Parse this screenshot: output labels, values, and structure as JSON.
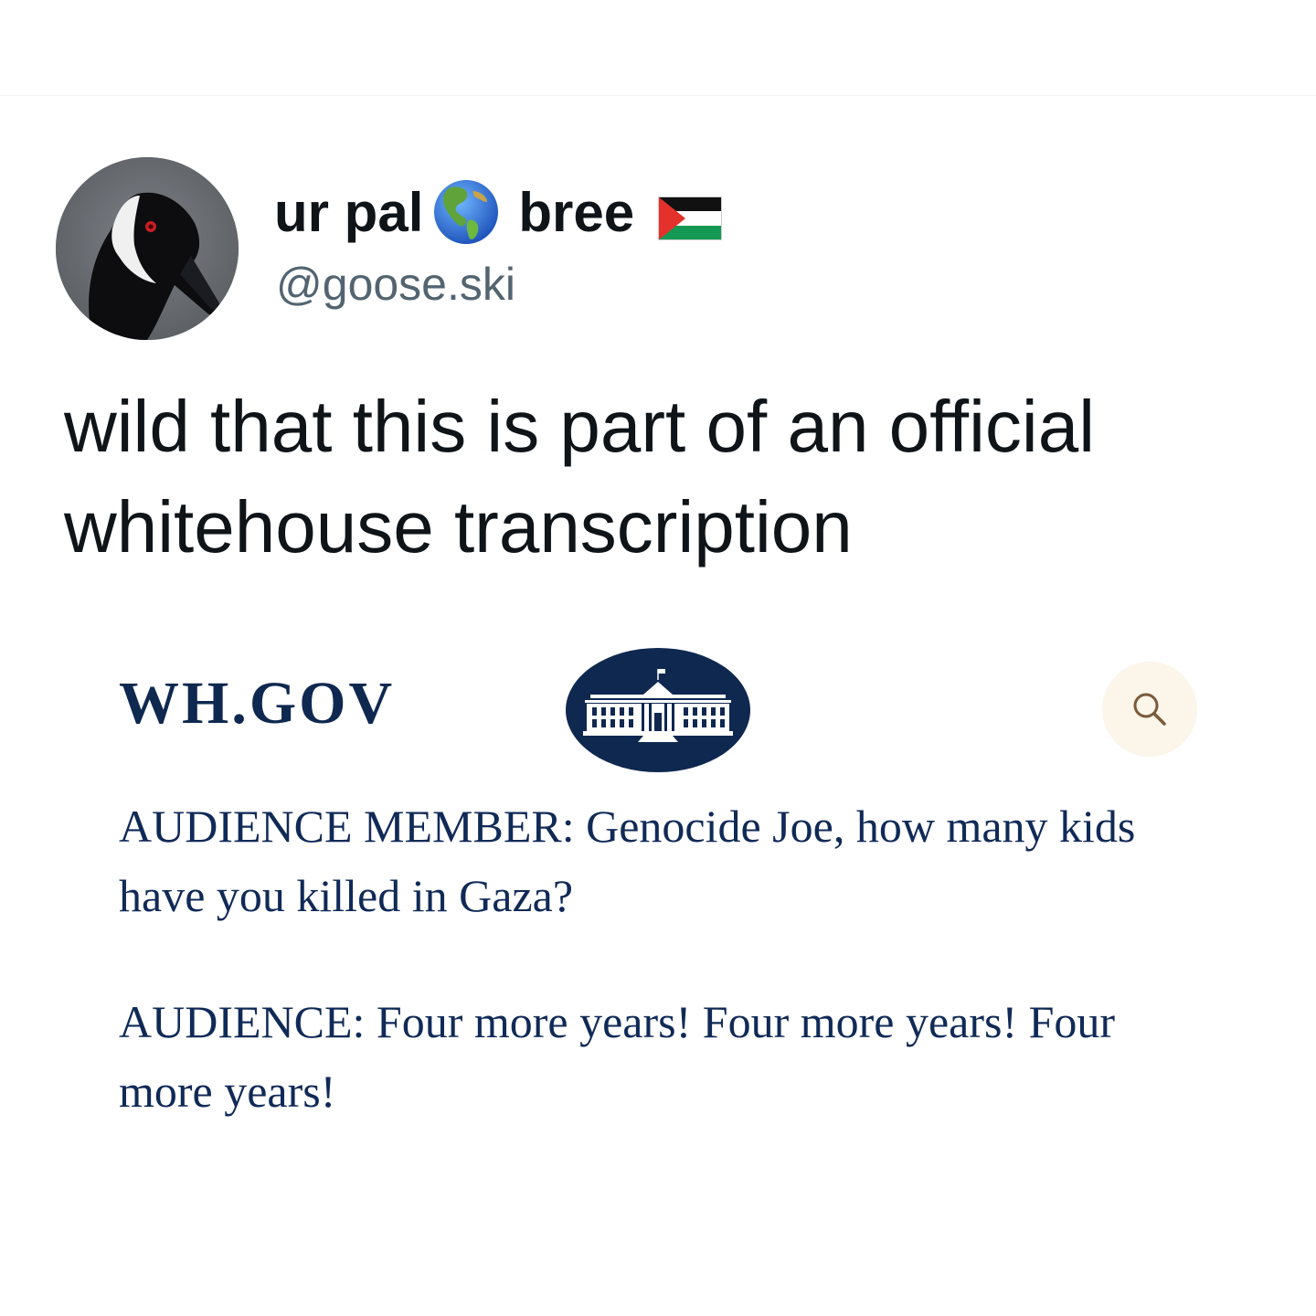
{
  "post": {
    "author": {
      "name_part1": "ur pal",
      "name_part2": "bree",
      "globe_emoji": "globe-americas-icon",
      "flag_emoji": "palestine-flag-icon",
      "handle": "@goose.ski",
      "avatar": "goose-avatar"
    },
    "text": "wild that this is part of an official whitehouse transcription"
  },
  "embedded_screenshot": {
    "site_logo": "WH.GOV",
    "seal": "white-house-seal-icon",
    "search_icon": "search-icon",
    "transcript": [
      {
        "speaker": "AUDIENCE MEMBER:",
        "line": "Genocide Joe, how many kids have you killed in Gaza?"
      },
      {
        "speaker": "AUDIENCE:",
        "line": "Four more years! Four more years! Four more years!"
      }
    ],
    "colors": {
      "navy": "#102a57",
      "search_bg": "#fbf5ea"
    }
  }
}
